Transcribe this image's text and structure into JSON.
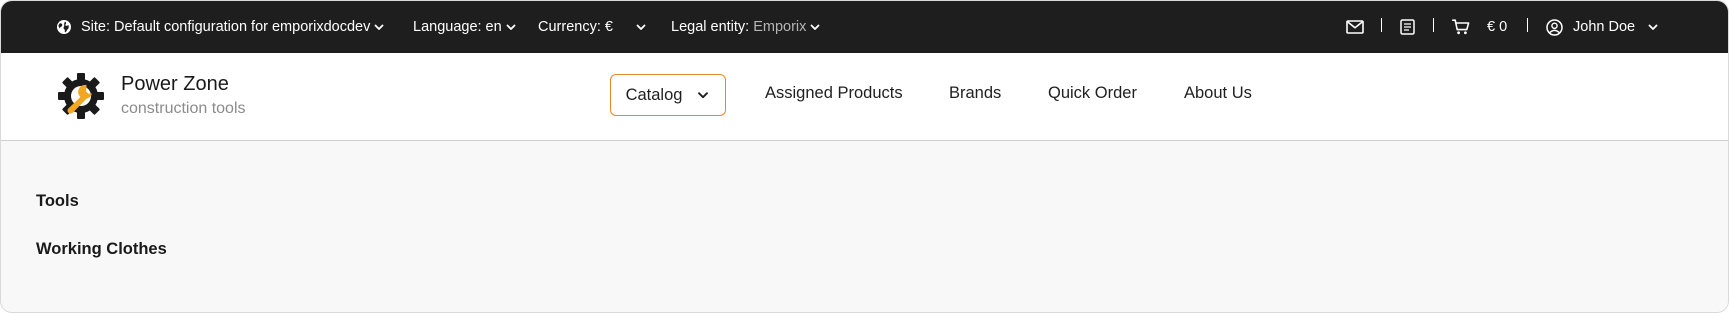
{
  "topbar": {
    "site": {
      "label": "Site:",
      "value": "Default configuration for emporixdocdev",
      "icon": "globe-icon"
    },
    "language": {
      "label": "Language:",
      "value": "en"
    },
    "currency": {
      "label": "Currency:",
      "value": "€"
    },
    "legal_entity": {
      "label": "Legal entity:",
      "value": "Emporix"
    },
    "icons": [
      "mail-icon",
      "document-list-icon",
      "cart-icon",
      "user-circle-icon"
    ],
    "cart_total": "€ 0",
    "user_name": "John Doe"
  },
  "header": {
    "brand_name": "Power Zone",
    "brand_tagline": "construction tools",
    "logo_colors": {
      "gear": "#1a1a1a",
      "wrench": "#f3a623"
    },
    "nav": {
      "catalog": "Catalog",
      "assigned_products": "Assigned Products",
      "brands": "Brands",
      "quick_order": "Quick Order",
      "about_us": "About Us"
    },
    "accent_color": "#e8892b"
  },
  "categories": [
    "Tools",
    "Working Clothes"
  ]
}
